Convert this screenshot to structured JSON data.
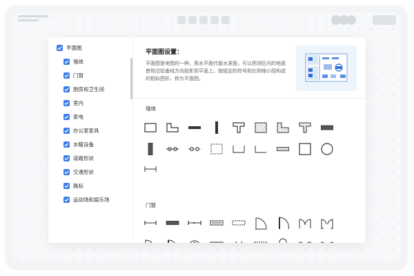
{
  "sidebar": {
    "root": {
      "label": "平面图",
      "checked": true
    },
    "items": [
      {
        "label": "墙体",
        "checked": true
      },
      {
        "label": "门窗",
        "checked": true
      },
      {
        "label": "厨房和卫生间",
        "checked": true
      },
      {
        "label": "室内",
        "checked": true
      },
      {
        "label": "家电",
        "checked": true
      },
      {
        "label": "办公室家具",
        "checked": true
      },
      {
        "label": "水暖设备",
        "checked": true
      },
      {
        "label": "道路形状",
        "checked": true
      },
      {
        "label": "交通形状",
        "checked": true
      },
      {
        "label": "路标",
        "checked": true
      },
      {
        "label": "运动场和娱乐场",
        "checked": true
      }
    ]
  },
  "content": {
    "title": "平面图设置：",
    "description": "平面图是地图的一种。用水平面代替水准面，可以把测区内的地面景物沿铅垂线方向投影到平面上，按规定的符号和比例缩小而构成的相似图形，称为平面图。",
    "sections": [
      {
        "label": "墙体"
      },
      {
        "label": "门窗"
      }
    ]
  },
  "colors": {
    "accent": "#3b7ee8",
    "preview_bg": "#eef4fc"
  }
}
